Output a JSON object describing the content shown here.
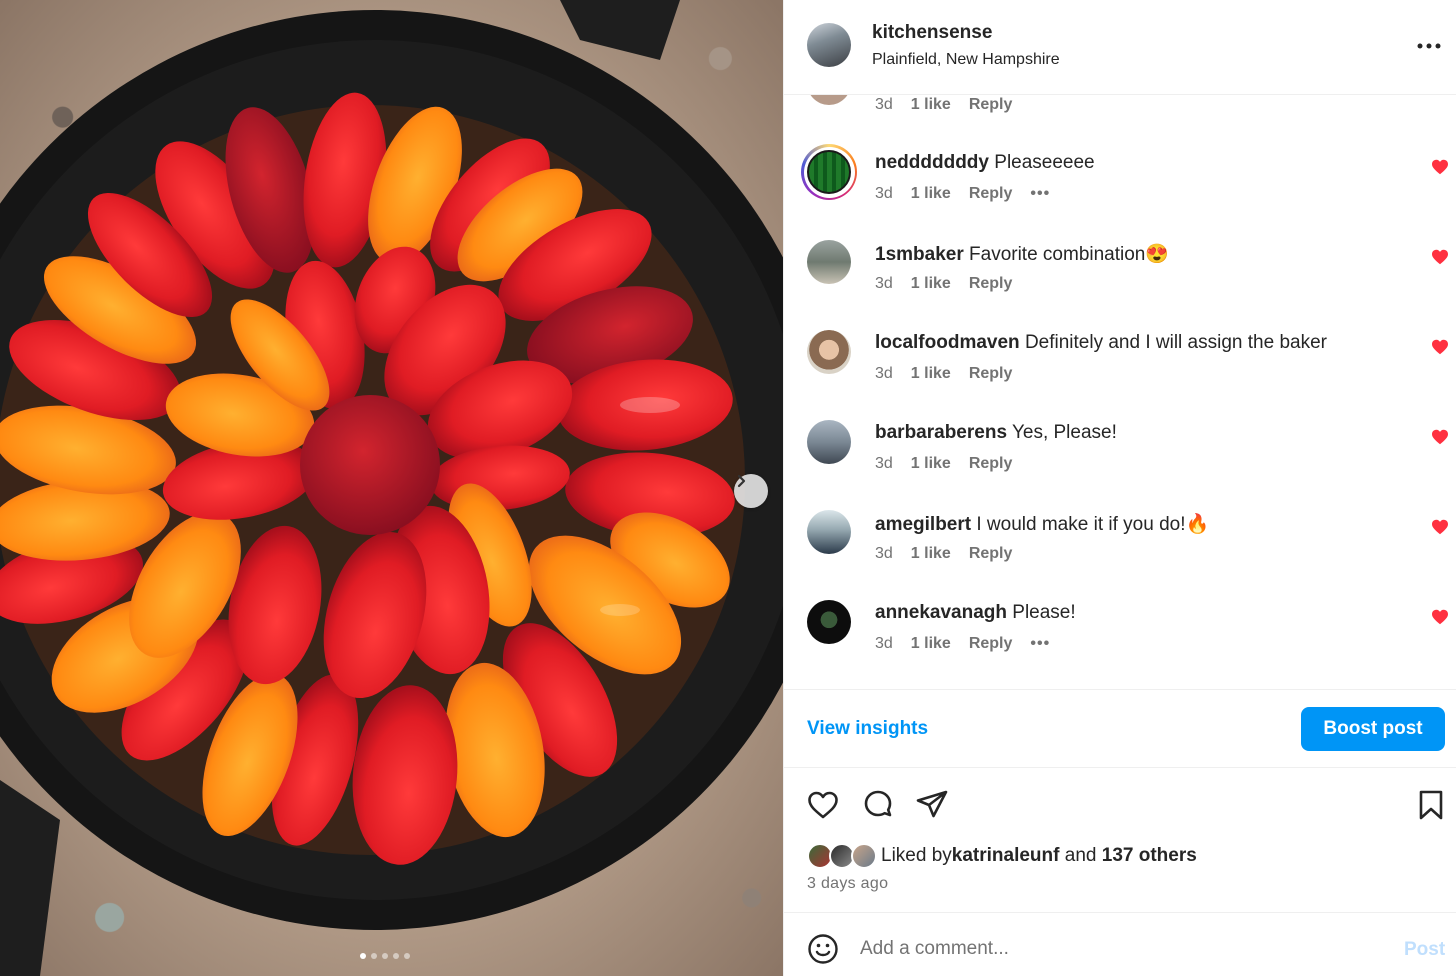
{
  "post": {
    "username": "kitchensense",
    "location": "Plainfield, New Hampshire",
    "more_icon": "more-horizontal-icon"
  },
  "partial_comment": {
    "time": "3d",
    "likes": "1 like",
    "reply": "Reply"
  },
  "comments": [
    {
      "username": "nedddddddy",
      "text": "Pleaseeeee",
      "time": "3d",
      "likes": "1 like",
      "reply": "Reply",
      "has_more": true,
      "has_story_ring": true
    },
    {
      "username": "1smbaker",
      "text": "Favorite combination😍",
      "time": "3d",
      "likes": "1 like",
      "reply": "Reply",
      "has_more": false
    },
    {
      "username": "localfoodmaven",
      "text": "Definitely and I will assign the baker",
      "time": "3d",
      "likes": "1 like",
      "reply": "Reply",
      "has_more": false
    },
    {
      "username": "barbaraberens",
      "text": "Yes, Please!",
      "time": "3d",
      "likes": "1 like",
      "reply": "Reply",
      "has_more": false
    },
    {
      "username": "amegilbert",
      "text": "I would make it if you do!🔥",
      "time": "3d",
      "likes": "1 like",
      "reply": "Reply",
      "has_more": false
    },
    {
      "username": "annekavanagh",
      "text": "Please!",
      "time": "3d",
      "likes": "1 like",
      "reply": "Reply",
      "has_more": true
    }
  ],
  "more_dots": "•••",
  "insights": {
    "view_label": "View insights",
    "boost_label": "Boost post"
  },
  "likes_summary": {
    "prefix": "Liked by ",
    "user": "katrinaleunf",
    "middle": " and ",
    "others": "137 others"
  },
  "time_ago": "3 days ago",
  "add_comment": {
    "placeholder": "Add a comment...",
    "post_label": "Post"
  },
  "colors": {
    "accent_blue": "#0095f6",
    "heart_red": "#ff3040",
    "muted_text": "#737373",
    "post_disabled": "#c0dffd"
  },
  "carousel": {
    "slide_count": 5,
    "active_slide": 1
  }
}
